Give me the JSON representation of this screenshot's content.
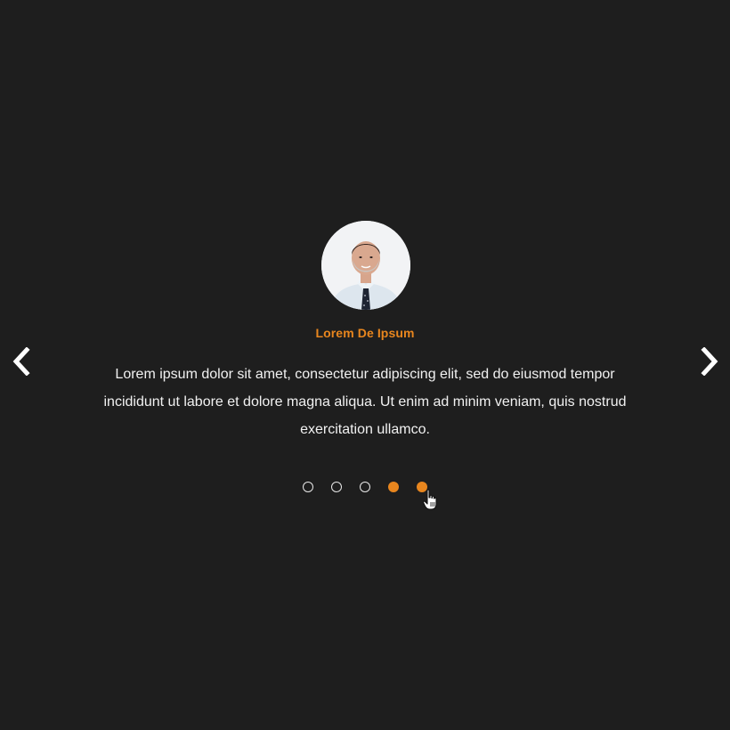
{
  "colors": {
    "background": "#1e1e1e",
    "accent": "#e8861e",
    "text": "#f1f1f1",
    "dot_inactive_border": "#e8e8e8"
  },
  "carousel": {
    "prev_icon": "chevron-left-icon",
    "next_icon": "chevron-right-icon",
    "slide": {
      "name": "Lorem De Ipsum",
      "quote": "Lorem ipsum dolor sit amet, consectetur adipiscing elit, sed do eiusmod tempor incididunt ut labore et dolore magna aliqua. Ut enim ad minim veniam, quis nostrud exercitation ullamco."
    },
    "dots": [
      {
        "active": false
      },
      {
        "active": false
      },
      {
        "active": false
      },
      {
        "active": true
      },
      {
        "active": true
      }
    ]
  }
}
